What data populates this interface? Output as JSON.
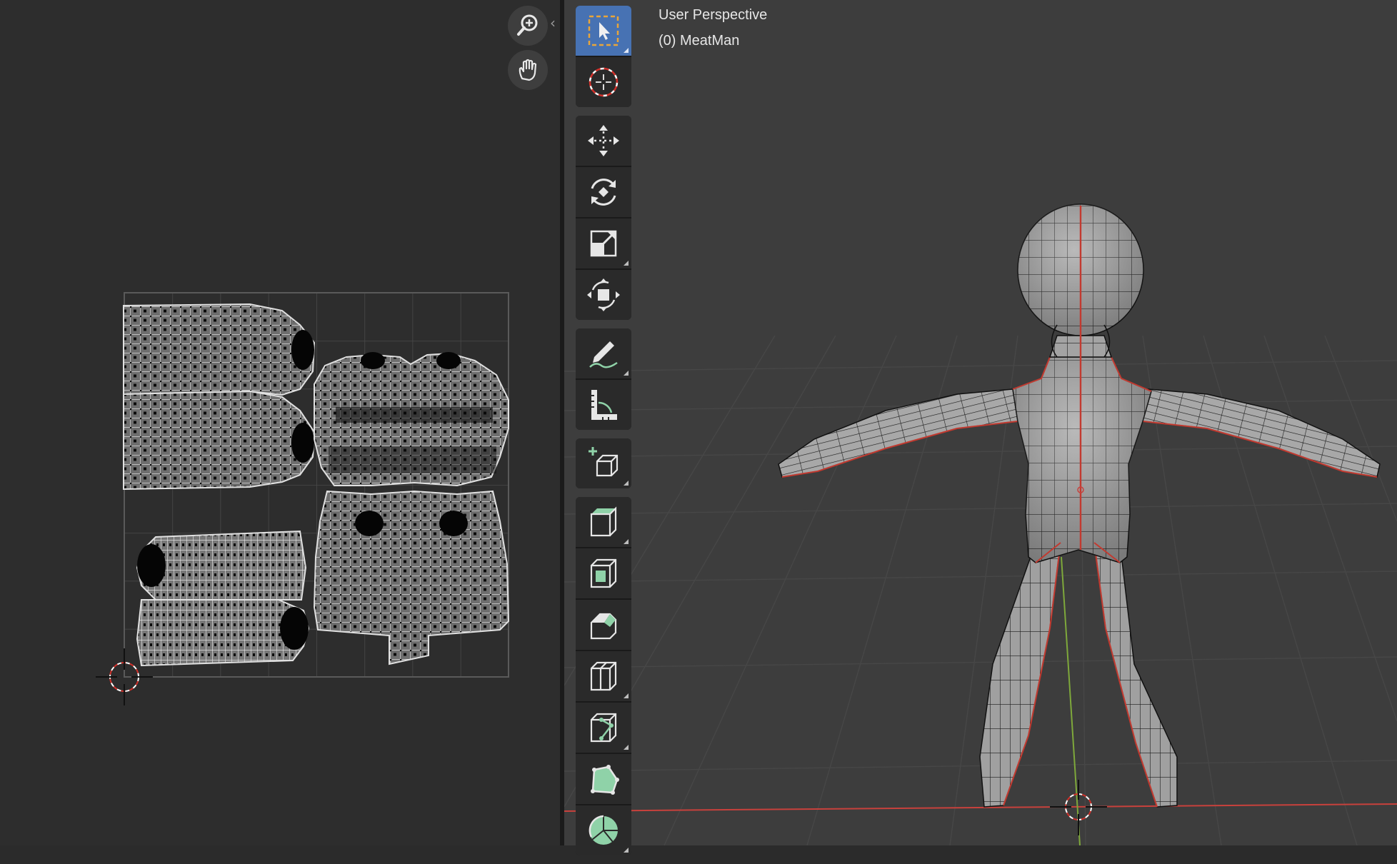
{
  "viewport": {
    "perspective_label": "User Perspective",
    "object_label": "(0) MeatMan"
  },
  "uv_editor": {
    "nav_buttons": [
      {
        "name": "zoom",
        "icon": "zoom-in-icon"
      },
      {
        "name": "pan",
        "icon": "hand-icon"
      }
    ]
  },
  "toolbar": {
    "groups": [
      [
        "select-box-icon",
        "cursor-icon"
      ],
      [
        "move-icon",
        "rotate-icon",
        "scale-icon",
        "transform-icon"
      ],
      [
        "annotate-icon",
        "measure-icon"
      ],
      [
        "add-cube-icon"
      ],
      [
        "extrude-icon",
        "inset-icon",
        "bevel-icon",
        "loop-cut-icon",
        "knife-icon",
        "poly-build-icon",
        "spin-icon"
      ]
    ],
    "active_tool": "select-box-icon"
  },
  "colors": {
    "accent": "#4772b3",
    "seam": "#d0302a",
    "x_axis": "#c8413c",
    "y_axis": "#7ea83b",
    "tool_green": "#8fd2a8"
  }
}
